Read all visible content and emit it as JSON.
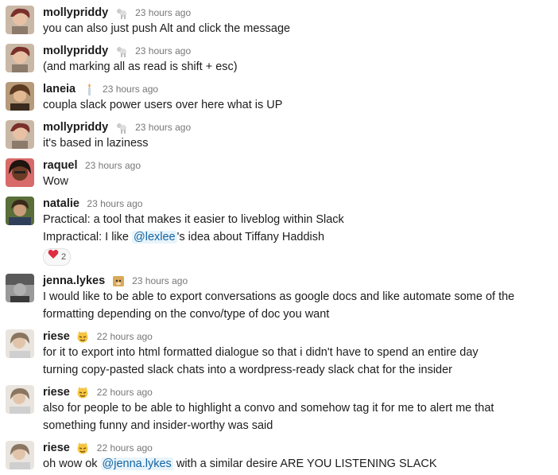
{
  "messages": [
    {
      "name": "mollypriddy",
      "status_icon": "poodle-icon",
      "time": "23 hours ago",
      "lines": [
        "you can also just push Alt and click the message"
      ]
    },
    {
      "name": "mollypriddy",
      "status_icon": "poodle-icon",
      "time": "23 hours ago",
      "lines": [
        "(and marking all as read is shift + esc)"
      ]
    },
    {
      "name": "laneia",
      "status_icon": "candle-icon",
      "time": "23 hours ago",
      "lines": [
        "coupla slack power users over here what is UP"
      ]
    },
    {
      "name": "mollypriddy",
      "status_icon": "poodle-icon",
      "time": "23 hours ago",
      "lines": [
        "it's based in laziness"
      ]
    },
    {
      "name": "raquel",
      "time": "23 hours ago",
      "lines": [
        "Wow"
      ]
    },
    {
      "name": "natalie",
      "time": "23 hours ago",
      "lines": [
        "Practical: a tool that makes it easier to liveblog within Slack"
      ],
      "line2_prefix": "Impractical: I like ",
      "line2_mention": "@lexlee",
      "line2_suffix": "'s idea about Tiffany Haddish",
      "reaction_count": "2"
    },
    {
      "name": "jenna.lykes",
      "status_icon": "doge-icon",
      "time": "23 hours ago",
      "lines": [
        "I would like to be able to export conversations as google docs and like automate some of the",
        "formatting depending on the convo/type of doc you want"
      ]
    },
    {
      "name": "riese",
      "status_icon": "cat-face-icon",
      "time": "22 hours ago",
      "lines": [
        "for it to export into html formatted dialogue so that i didn't have to spend an entire day",
        "turning copy-pasted slack chats into a wordpress-ready slack chat for the insider"
      ]
    },
    {
      "name": "riese",
      "status_icon": "cat-face-icon",
      "time": "22 hours ago",
      "lines": [
        "also for people to be able to highlight a convo and somehow tag it for me to alert me that",
        "something funny and insider-worthy was said"
      ]
    },
    {
      "name": "riese",
      "status_icon": "cat-face-icon",
      "time": "22 hours ago",
      "line_prefix": "oh wow ok ",
      "line_mention": "@jenna.lykes",
      "line_suffix": " with a similar desire ARE YOU LISTENING SLACK"
    }
  ],
  "colors": {
    "mention": "#1264a3",
    "mention_bg": "#e8f4fb",
    "timestamp": "#777777",
    "heart": "#dd2e44"
  }
}
